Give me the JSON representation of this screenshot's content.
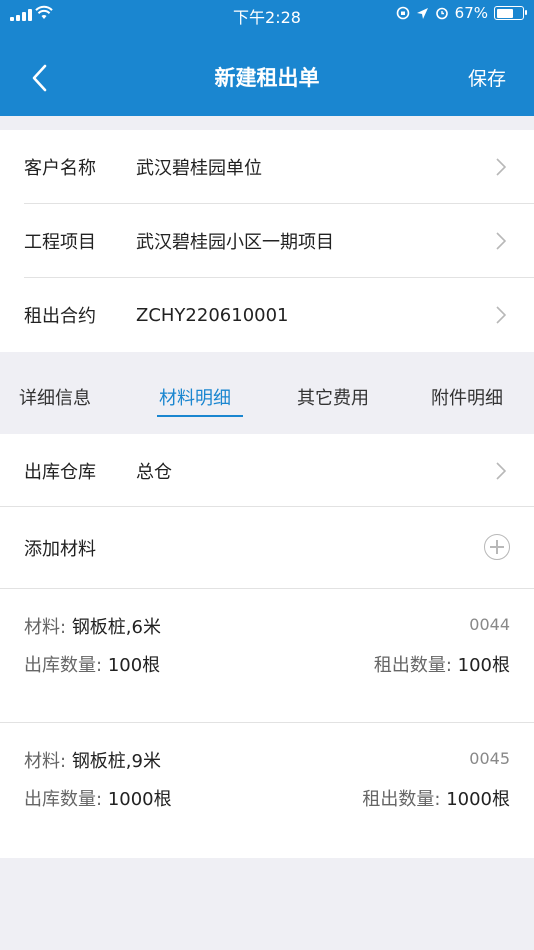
{
  "status_bar": {
    "time": "下午2:28",
    "battery": "67%",
    "battery_level": 0.67
  },
  "nav": {
    "title": "新建租出单",
    "save_label": "保存",
    "back_icon": "chevron-left-icon"
  },
  "form": {
    "customer": {
      "label": "客户名称",
      "value": "武汉碧桂园单位"
    },
    "project": {
      "label": "工程项目",
      "value": "武汉碧桂园小区一期项目"
    },
    "contract": {
      "label": "租出合约",
      "value": "ZCHY220610001"
    }
  },
  "tabs": [
    {
      "label": "详细信息",
      "active": false
    },
    {
      "label": "材料明细",
      "active": true
    },
    {
      "label": "其它费用",
      "active": false
    },
    {
      "label": "附件明细",
      "active": false
    }
  ],
  "warehouse": {
    "label": "出库仓库",
    "value": "总仓"
  },
  "add_material": {
    "label": "添加材料"
  },
  "materials": [
    {
      "name_label": "材料:",
      "name": "钢板桩,6米",
      "code": "0044",
      "out_label": "出库数量:",
      "out_qty": "100根",
      "rent_label": "租出数量:",
      "rent_qty": "100根"
    },
    {
      "name_label": "材料:",
      "name": "钢板桩,9米",
      "code": "0045",
      "out_label": "出库数量:",
      "out_qty": "1000根",
      "rent_label": "租出数量:",
      "rent_qty": "1000根"
    }
  ],
  "colors": {
    "primary": "#1a86d0",
    "background": "#efeff4",
    "card": "#ffffff"
  }
}
